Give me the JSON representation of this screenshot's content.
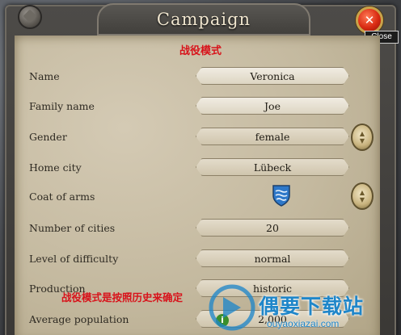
{
  "window": {
    "title": "Campaign",
    "close_tooltip": "Close",
    "subtitle_cn": "战役模式"
  },
  "form": {
    "rows": [
      {
        "label": "Name",
        "value": "Veronica"
      },
      {
        "label": "Family name",
        "value": "Joe"
      },
      {
        "label": "Gender",
        "value": "female"
      },
      {
        "label": "Home city",
        "value": "Lübeck"
      },
      {
        "label": "Coat of arms",
        "value": ""
      },
      {
        "label": "Number of cities",
        "value": "20"
      },
      {
        "label": "Level of difficulty",
        "value": "normal"
      },
      {
        "label": "Production",
        "value": "historic"
      },
      {
        "label": "Average population",
        "value": "2,000"
      }
    ]
  },
  "annotation_cn": "战役模式是按照历史来确定",
  "watermark": {
    "text": "偶要下载站",
    "url": "ouyaoxiazai.com"
  },
  "colors": {
    "parchment": "#c4b99f",
    "annotation_red": "#d8131b",
    "watermark_blue": "#1f86c9",
    "close_red": "#d82a12"
  }
}
